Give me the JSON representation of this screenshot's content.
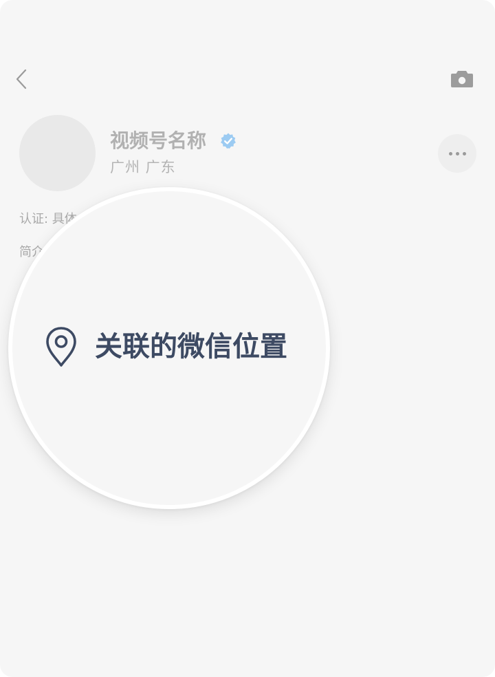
{
  "profile": {
    "name": "视频号名称",
    "location": "广州 广东"
  },
  "details": {
    "certification_partial": "认证: 具体",
    "intro_partial": "简介"
  },
  "magnifier": {
    "location_link_label": "关联的微信位置"
  },
  "icons": {
    "back": "chevron-left-icon",
    "camera": "camera-icon",
    "verified": "verified-badge-icon",
    "more": "more-dots-icon",
    "location": "location-pin-icon"
  },
  "colors": {
    "background": "#f6f6f6",
    "verified_badge": "#9ccbf2",
    "location_link": "#3d4a63"
  }
}
